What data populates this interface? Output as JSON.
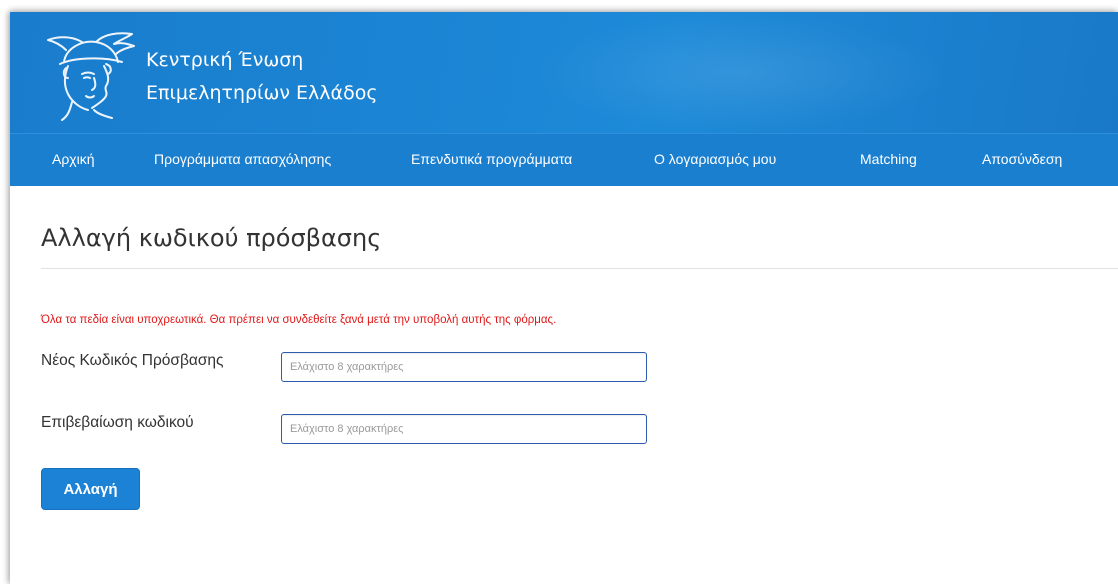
{
  "header": {
    "title_line1": "Κεντρική Ένωση",
    "title_line2": "Επιμελητηρίων Ελλάδος",
    "logo_icon": "hermes-head-logo-icon"
  },
  "nav": {
    "items": [
      {
        "label": "Αρχική"
      },
      {
        "label": "Προγράμματα απασχόλησης"
      },
      {
        "label": "Επενδυτικά προγράμματα"
      },
      {
        "label": "Ο λογαριασμός μου"
      },
      {
        "label": "Matching"
      },
      {
        "label": "Αποσύνδεση"
      }
    ]
  },
  "main": {
    "title": "Αλλαγή κωδικού πρόσβασης",
    "notice": "Όλα τα πεδία είναι υποχρεωτικά. Θα πρέπει να συνδεθείτε ξανά μετά την υποβολή αυτής της φόρμας.",
    "fields": [
      {
        "label": "Νέος Κωδικός Πρόσβασης",
        "placeholder": "Ελάχιστο 8 χαρακτήρες",
        "value": ""
      },
      {
        "label": "Επιβεβαίωση κωδικού",
        "placeholder": "Ελάχιστο 8 χαρακτήρες",
        "value": ""
      }
    ],
    "submit_label": "Αλλαγή"
  },
  "colors": {
    "brand_blue": "#1b7fd0",
    "notice_red": "#e01818"
  }
}
